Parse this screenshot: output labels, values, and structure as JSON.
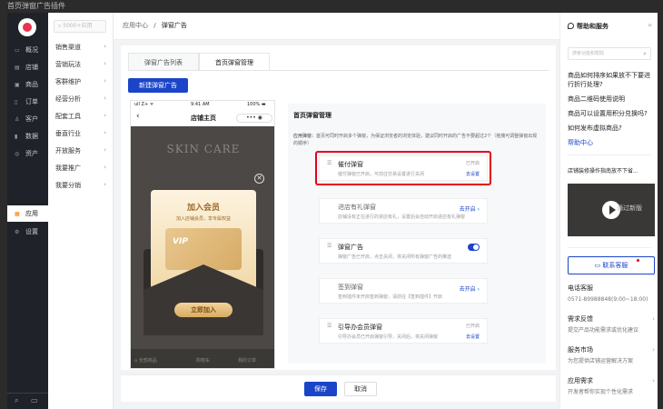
{
  "window": {
    "title": "首页弹窗广告插件"
  },
  "rail": {
    "items": [
      {
        "icon": "overview-icon",
        "label": "概况"
      },
      {
        "icon": "store-icon",
        "label": "店铺"
      },
      {
        "icon": "product-icon",
        "label": "商品"
      },
      {
        "icon": "order-icon",
        "label": "订单"
      },
      {
        "icon": "customer-icon",
        "label": "客户"
      },
      {
        "icon": "data-icon",
        "label": "数据"
      },
      {
        "icon": "asset-icon",
        "label": "资产"
      },
      {
        "icon": "apps-icon",
        "label": "应用"
      },
      {
        "icon": "settings-icon",
        "label": "设置"
      }
    ],
    "accent": "#ff7a00"
  },
  "sub": {
    "search_placeholder": "5000+应用",
    "items": [
      "销售渠道",
      "营销玩法",
      "客群维护",
      "经营分析",
      "配套工具",
      "垂直行业",
      "开放服务",
      "我要推广",
      "我要分销"
    ]
  },
  "breadcrumb": {
    "parent": "应用中心",
    "sep": "/",
    "current": "弹窗广告"
  },
  "tabs": [
    "弹窗广告列表",
    "首页弹窗管理"
  ],
  "new_button": "新建弹窗广告",
  "phone": {
    "time": "9:41 AM",
    "carrier": "ull Z+ ᯤ",
    "battery": "100% ▬",
    "title": "店铺主页",
    "more": "••• ◉",
    "skin_care": "SKIN CARE",
    "card_title": "加入会员",
    "card_sub": "加入店铺会员，享专属权益",
    "vip": "VIP",
    "join": "立即加入",
    "tabbar": [
      "⌂ 全部商品",
      "购物车",
      "我的订单"
    ]
  },
  "config": {
    "title": "首页弹窗管理",
    "desc_label": "应用弹窗：",
    "desc": "首页可同时开启多个弹窗，为保证浏览者的浏览体验，建议同时开启的广告不要超过2个（拖拽可调整弹窗出现的顺序）",
    "cards": [
      {
        "name": "催付弹窗",
        "desc": "催付弹窗已开启，可前往交易设置进行关闭",
        "status": "已开启",
        "link": "去设置"
      },
      {
        "name": "进店有礼弹窗",
        "desc": "店铺没有正在进行的进店有礼，设置后会自动开启进店有礼弹窗",
        "link": "去开启 ›"
      },
      {
        "name": "弹窗广告",
        "desc": "弹窗广告已开启，点击关闭，将关闭所有弹窗广告的推送",
        "toggle_on": true
      },
      {
        "name": "签到弹窗",
        "desc": "签到插件未开启签到弹窗，请前往【签到插件】开启",
        "link": "去开启 ›"
      },
      {
        "name": "引导办会员弹窗",
        "desc": "引导办会员已开启弹窗引导，关闭后，将关闭弹窗",
        "status": "已开启",
        "link": "去设置"
      }
    ],
    "highlight_color": "#e8001c"
  },
  "footer": {
    "save": "保存",
    "cancel": "取消"
  },
  "help": {
    "title": "帮助和服务",
    "collapse": "»",
    "search_placeholder": "搜索功能和帮助",
    "faq": [
      "商品如何排序如果放不下要进行折行处理?",
      "商品二维码使用说明",
      "商品可以设置用积分兑换吗?",
      "如何发布虚拟商品?"
    ],
    "help_center": "帮助中心",
    "video_title": "店铺装修操作指南放不下省...",
    "video_text": "通过新版",
    "contact": "联系客服",
    "phone_label": "电话客服",
    "phone_value": "0571-89988848(9:00~18:00)",
    "feedback": {
      "title": "需求反馈",
      "sub": "提交产品功能需求或优化建议"
    },
    "market": {
      "title": "服务市场",
      "sub": "为您提供店铺运营解决方案"
    },
    "app_needs": {
      "title": "应用需求",
      "sub": "开发者帮你实现个性化需求"
    },
    "accent": "#1a45c9"
  }
}
